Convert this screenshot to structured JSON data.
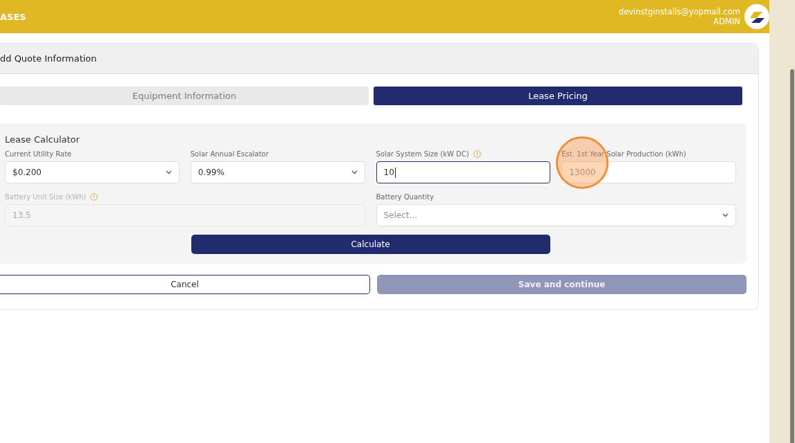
{
  "header": {
    "title": "ASES",
    "email": "devinstginstalls@yopmail.com",
    "role": "ADMIN"
  },
  "card": {
    "title": "dd Quote Information"
  },
  "tabs": [
    {
      "label": "Equipment Information",
      "selected": false
    },
    {
      "label": "Lease Pricing",
      "selected": true
    }
  ],
  "calculator": {
    "title": "Lease Calculator",
    "rows": [
      [
        {
          "kind": "select",
          "label": "Current Utility Rate",
          "value": "$0.200",
          "info": false,
          "disabled": false,
          "focused": false
        },
        {
          "kind": "select",
          "label": "Solar Annual Escalator",
          "value": "0.99%",
          "info": false,
          "disabled": false,
          "focused": false
        },
        {
          "kind": "input",
          "label": "Solar System Size (kW DC)",
          "value": "10",
          "info": true,
          "disabled": false,
          "focused": true
        },
        {
          "kind": "input",
          "label": "Est. 1st Year Solar Production (kWh)",
          "placeholder": "13000",
          "info": false,
          "disabled": false,
          "focused": false
        }
      ],
      [
        {
          "kind": "input",
          "label": "Battery Unit Size (kWh)",
          "value": "13.5",
          "info": true,
          "disabled": true,
          "focused": false
        },
        "",
        {
          "kind": "select",
          "label": "Battery Quantity",
          "placeholder": "Select...",
          "info": false,
          "disabled": false,
          "focused": false
        },
        ""
      ]
    ],
    "calculate": "Calculate"
  },
  "actions": [
    {
      "label": "Cancel",
      "kind": "outline",
      "disabled": false
    },
    {
      "label": "Save and continue",
      "kind": "primary",
      "disabled": true
    }
  ]
}
